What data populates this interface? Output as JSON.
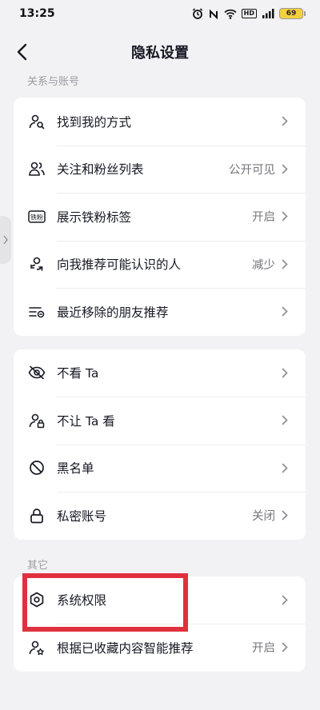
{
  "status_bar": {
    "time": "13:25",
    "battery": "69",
    "network_badge": "HD",
    "icons": [
      "alarm-icon",
      "nfc-icon",
      "wifi-icon",
      "signal-icon",
      "battery-icon"
    ]
  },
  "header": {
    "title": "隐私设置",
    "back_icon": "chevron-left-icon"
  },
  "sections": [
    {
      "label": "关系与账号",
      "items": [
        {
          "label": "找到我的方式",
          "value": "",
          "icon": "person-search-icon"
        },
        {
          "label": "关注和粉丝列表",
          "value": "公开可见",
          "icon": "people-icon"
        },
        {
          "label": "展示铁粉标签",
          "value": "开启",
          "icon": "fan-badge-icon",
          "badge": "铁粉"
        },
        {
          "label": "向我推荐可能认识的人",
          "value": "减少",
          "icon": "recommend-people-icon"
        },
        {
          "label": "最近移除的朋友推荐",
          "value": "",
          "icon": "list-remove-icon"
        }
      ]
    },
    {
      "label": "",
      "items": [
        {
          "label": "不看 Ta",
          "value": "",
          "icon": "eye-off-icon"
        },
        {
          "label": "不让 Ta 看",
          "value": "",
          "icon": "person-lock-icon"
        },
        {
          "label": "黑名单",
          "value": "",
          "icon": "block-icon"
        },
        {
          "label": "私密账号",
          "value": "关闭",
          "icon": "lock-icon"
        }
      ]
    },
    {
      "label": "其它",
      "items": [
        {
          "label": "系统权限",
          "value": "",
          "icon": "hex-gear-icon"
        },
        {
          "label": "根据已收藏内容智能推荐",
          "value": "开启",
          "icon": "person-star-icon"
        }
      ]
    }
  ],
  "colors": {
    "background": "#f2f2f4",
    "card": "#ffffff",
    "text": "#161823",
    "secondary_text": "#75767c",
    "highlight": "#e0303e"
  }
}
